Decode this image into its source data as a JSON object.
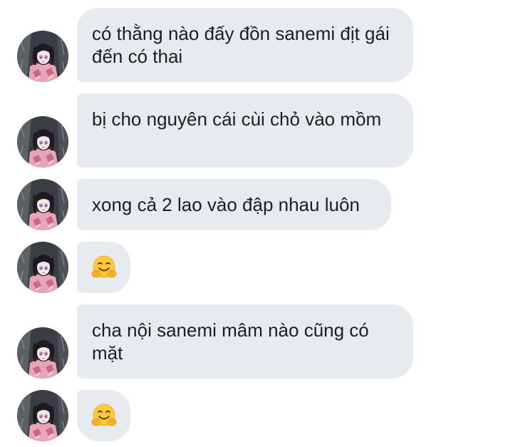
{
  "chat": {
    "avatar_icon": "profile-avatar-icon",
    "messages": [
      {
        "type": "text",
        "text": "có thằng nào đấy đồn sanemi địt gái đến có thai"
      },
      {
        "type": "text",
        "text": "bị cho nguyên cái cùi chỏ vào mồm"
      },
      {
        "type": "text",
        "text": "xong cả 2 lao vào đập nhau luôn"
      },
      {
        "type": "emoji",
        "emoji": "hugging-face-emoji"
      },
      {
        "type": "text",
        "text": "cha nội sanemi mâm nào cũng có mặt"
      },
      {
        "type": "emoji",
        "emoji": "hugging-face-emoji"
      }
    ]
  },
  "colors": {
    "bubble_bg": "#e7ebf0",
    "text": "#1c1e21",
    "page_bg": "#ffffff"
  }
}
